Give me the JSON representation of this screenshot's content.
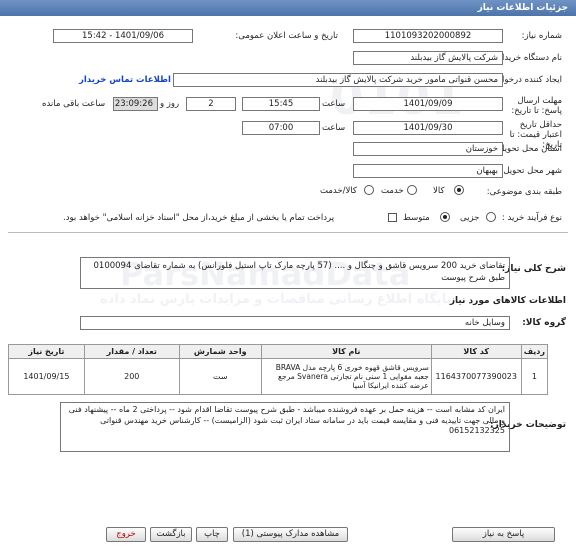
{
  "header": {
    "title": "جزئیات اطلاعات نیاز"
  },
  "form": {
    "need_number_label": "شماره نیاز:",
    "need_number": "1101093202000892",
    "announce_label": "تاریخ و ساعت اعلان عمومی:",
    "announce_value": "1401/09/06 - 15:42",
    "buyer_label": "نام دستگاه خریدار:",
    "buyer_value": "شرکت پالایش گاز بیدبلند",
    "creator_label": "ایجاد کننده درخواست:",
    "creator_value": "محسن قنواتی مامور خرید شرکت پالایش گاز بیدبلند",
    "contact_link": "اطلاعات تماس خریدار",
    "deadline_label": "مهلت ارسال پاسخ: تا تاریخ:",
    "deadline_date": "1401/09/09",
    "time_label": "ساعت",
    "deadline_time": "15:45",
    "days_value": "2",
    "days_label": "روز و",
    "remaining_time": "23:09:26",
    "remaining_label": "ساعت باقی مانده",
    "validity_label": "حداقل تاریخ اعتبار قیمت: تا تاریخ:",
    "validity_date": "1401/09/30",
    "validity_time_label": "ساعت",
    "validity_time": "07:00",
    "province_label": "استان محل تحویل:",
    "province_value": "خوزستان",
    "city_label": "شهر محل تحویل:",
    "city_value": "بهبهان",
    "category_label": "طبقه بندی موضوعی:",
    "category_options": [
      "کالا",
      "خدمت",
      "کالا/خدمت"
    ],
    "process_label": "نوع فرآیند خرید :",
    "process_options": [
      "جزیی",
      "متوسط"
    ],
    "payment_note": "پرداخت تمام یا بخشی از مبلغ خرید،از محل \"اسناد خزانه اسلامی\" خواهد بود."
  },
  "summary": {
    "label": "شرح کلی نیاز:",
    "text": "تقاضای خرید 200 سرویس قاشق و چنگال و .... (57 پارچه مارک تاپ استیل فلورانس) به شماره تقاضای 0100094 طبق شرح پیوست"
  },
  "goods": {
    "section_title": "اطلاعات کالاهای مورد نیاز",
    "group_label": "گروه کالا:",
    "group_value": "وسایل خانه",
    "columns": [
      "ردیف",
      "کد کالا",
      "نام کالا",
      "واحد شمارش",
      "تعداد / مقدار",
      "تاریخ نیاز"
    ],
    "rows": [
      {
        "index": "1",
        "code": "1164370077390023",
        "name": "سرویس قاشق قهوه خوری 6 پارچه مدل BRAVA جعبه مقوایی 1 سنی نام تجارتی Svanera مرجع عرضه کننده ایرانیکا آسیا",
        "unit": "ست",
        "qty": "200",
        "date": "1401/09/15"
      }
    ]
  },
  "buyer_notes": {
    "label": "توضیحات خریدار:",
    "text": "ایران کد مشابه است -- هزینه حمل بر عهده فروشنده میباشد - طبق شرح پیوست تقاضا اقدام شود -- پرداختی 2 ماه -- پیشنهاد فنی و مالی جهت تاییدیه فنی و مقایسه قیمت باید در سامانه ستاد ایران ثبت شود (الزامیست) -- کارشناس خرید مهندس قنواتی 06152132325"
  },
  "buttons": {
    "reply": "پاسخ به نیاز",
    "docs": "مشاهده مدارک پیوستی (1)",
    "print": "چاپ",
    "back": "بازگشت",
    "exit": "خروج"
  },
  "watermark": {
    "brand": "ParsNamadData",
    "sub": "پایگاه اطلاع رسانی مناقصات و مزایدات پارس نماد داده"
  }
}
